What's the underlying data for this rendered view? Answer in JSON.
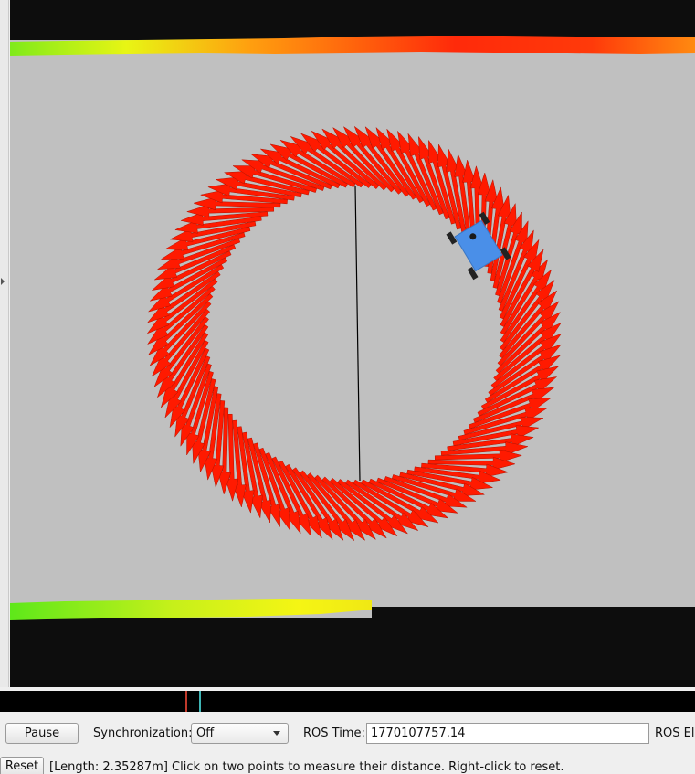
{
  "viewport": {
    "background": "#c0c0c0",
    "wall_color": "#0d0d0d",
    "pose_arrow_color": "#ff1a00",
    "robot_color": "#4a8fe8",
    "path_line_color": "#000000",
    "robot_icon": "robot-icon",
    "pose_arrows_icon": "pose-array-arrow-icon"
  },
  "time_panel": {
    "pause_label": "Pause",
    "sync_label": "Synchronization:",
    "sync_value": "Off",
    "ros_time_label": "ROS Time:",
    "ros_time_value": "1770107757.14",
    "ros_elapsed_label": "ROS Ela"
  },
  "status_bar": {
    "reset_label": "Reset",
    "message": "[Length: 2.35287m] Click on two points to measure their distance. Right-click to reset."
  }
}
